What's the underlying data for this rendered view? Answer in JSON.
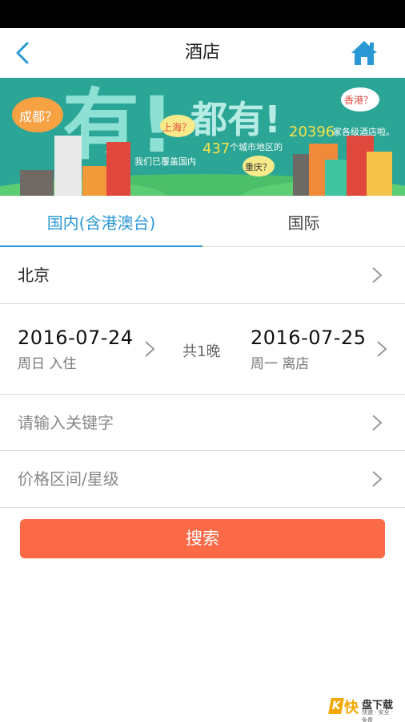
{
  "nav": {
    "title": "酒店"
  },
  "banner": {
    "headline_big": "有!",
    "headline_2": "都有!",
    "tag_chengdu": "成都？",
    "tag_shanghai": "上海？",
    "tag_hongkong": "香港？",
    "tag_chongqing": "重庆？",
    "text_prefix": "我们已覆盖国内",
    "city_count": "437",
    "text_mid": "个城市地区的",
    "hotel_count": "20396",
    "text_suffix": "家各级酒店啦。"
  },
  "tabs": {
    "domestic": "国内(含港澳台)",
    "international": "国际"
  },
  "form": {
    "city": "北京",
    "checkin_date": "2016-07-24",
    "checkin_sub": "周日 入住",
    "nights": "共1晚",
    "checkout_date": "2016-07-25",
    "checkout_sub": "周一 离店",
    "keyword_placeholder": "请输入关键字",
    "price_placeholder": "价格区间/星级"
  },
  "search_button": "搜索",
  "watermark": {
    "k": "K",
    "kuai": "快",
    "main": "盘下载",
    "sub": "快速 · 安全 · 免费"
  },
  "colors": {
    "accent_blue": "#2a98d5",
    "search_orange": "#fa6a46",
    "banner_teal": "#2aa596"
  }
}
